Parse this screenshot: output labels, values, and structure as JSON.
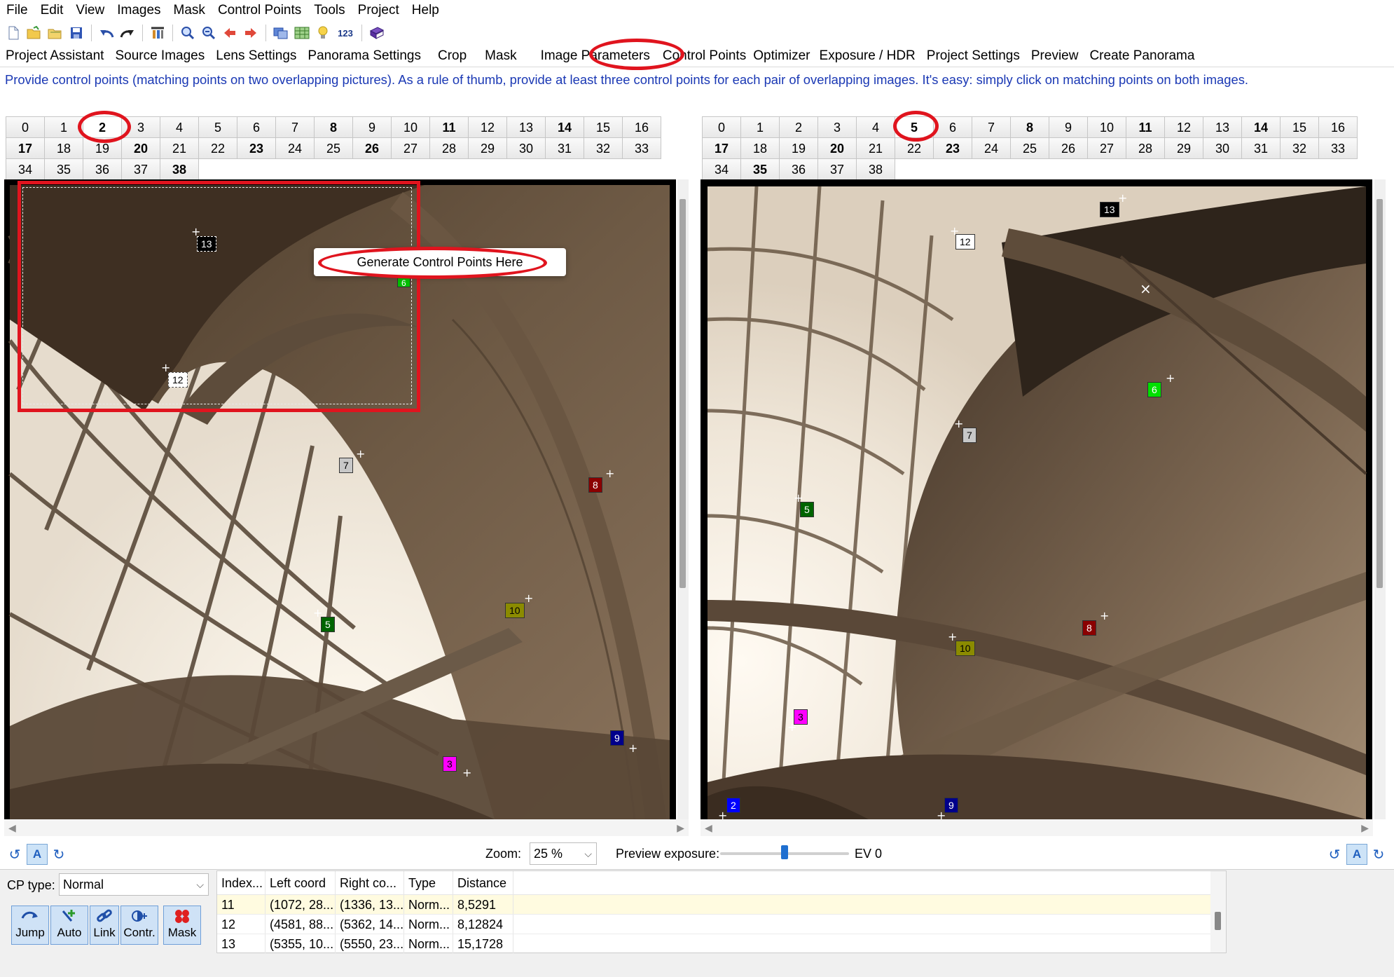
{
  "menu": [
    "File",
    "Edit",
    "View",
    "Images",
    "Mask",
    "Control Points",
    "Tools",
    "Project",
    "Help"
  ],
  "toolbar": {
    "icons": [
      "new-file-icon",
      "open-folder-icon",
      "open-recent-icon",
      "save-icon",
      "undo-icon",
      "redo-icon",
      "assistant-icon",
      "zoom-in-icon",
      "zoom-out-icon",
      "previous-icon",
      "next-icon",
      "images-icon",
      "table-icon",
      "bulb-icon",
      "number-icon",
      "book-icon"
    ],
    "number_label": "123"
  },
  "tabs": [
    "Project Assistant",
    "Source Images",
    "Lens Settings",
    "Panorama Settings",
    "Crop",
    "Mask",
    "Image Parameters",
    "Control Points",
    "Optimizer",
    "Exposure / HDR",
    "Project Settings",
    "Preview",
    "Create Panorama"
  ],
  "active_tab": "Control Points",
  "info_text": "Provide control points (matching points on two overlapping pictures). As a rule of thumb, provide at least three control points for each pair of overlapping images. It's easy: simply click on matching points on both images.",
  "left_images": {
    "numbers": [
      "0",
      "1",
      "2",
      "3",
      "4",
      "5",
      "6",
      "7",
      "8",
      "9",
      "10",
      "11",
      "12",
      "13",
      "14",
      "15",
      "16",
      "17",
      "18",
      "19",
      "20",
      "21",
      "22",
      "23",
      "24",
      "25",
      "26",
      "27",
      "28",
      "29",
      "30",
      "31",
      "32",
      "33",
      "34",
      "35",
      "36",
      "37",
      "38"
    ],
    "bold": [
      "2",
      "8",
      "11",
      "14",
      "17",
      "20",
      "23",
      "26",
      "38"
    ],
    "selected": "2"
  },
  "right_images": {
    "numbers": [
      "0",
      "1",
      "2",
      "3",
      "4",
      "5",
      "6",
      "7",
      "8",
      "9",
      "10",
      "11",
      "12",
      "13",
      "14",
      "15",
      "16",
      "17",
      "18",
      "19",
      "20",
      "21",
      "22",
      "23",
      "24",
      "25",
      "26",
      "27",
      "28",
      "29",
      "30",
      "31",
      "32",
      "33",
      "34",
      "35",
      "36",
      "37",
      "38"
    ],
    "bold": [
      "5",
      "8",
      "11",
      "14",
      "17",
      "20",
      "23",
      "35"
    ],
    "selected": "5"
  },
  "left_points": [
    {
      "label": "13",
      "color": "#000000",
      "text": "#ffffff"
    },
    {
      "label": "6",
      "color": "#00c000",
      "text": "#ffffff"
    },
    {
      "label": "12",
      "color": "#ffffff",
      "text": "#000000"
    },
    {
      "label": "7",
      "color": "#c8c8c8",
      "text": "#000000"
    },
    {
      "label": "8",
      "color": "#8b0000",
      "text": "#ffffff"
    },
    {
      "label": "10",
      "color": "#8b8b00",
      "text": "#000000"
    },
    {
      "label": "5",
      "color": "#006400",
      "text": "#ffffff"
    },
    {
      "label": "9",
      "color": "#00008b",
      "text": "#ffffff"
    },
    {
      "label": "3",
      "color": "#ff00ff",
      "text": "#000000"
    }
  ],
  "right_points": [
    {
      "label": "13",
      "color": "#000000",
      "text": "#ffffff"
    },
    {
      "label": "12",
      "color": "#ffffff",
      "text": "#000000"
    },
    {
      "label": "6",
      "color": "#00e000",
      "text": "#ffffff"
    },
    {
      "label": "7",
      "color": "#c8c8c8",
      "text": "#000000"
    },
    {
      "label": "5",
      "color": "#006400",
      "text": "#ffffff"
    },
    {
      "label": "10",
      "color": "#8b8b00",
      "text": "#000000"
    },
    {
      "label": "8",
      "color": "#8b0000",
      "text": "#ffffff"
    },
    {
      "label": "3",
      "color": "#ff00ff",
      "text": "#000000"
    },
    {
      "label": "2",
      "color": "#0000ff",
      "text": "#ffffff"
    },
    {
      "label": "9",
      "color": "#00008b",
      "text": "#ffffff"
    }
  ],
  "context_menu_item": "Generate Control Points Here",
  "zoom": {
    "label": "Zoom:",
    "value": "25 %"
  },
  "exposure": {
    "label": "Preview exposure:",
    "value": "EV 0"
  },
  "a_button": "A",
  "cp_type": {
    "label": "CP type:",
    "value": "Normal"
  },
  "cp_buttons": [
    {
      "label": "Jump",
      "icon": "jump-icon"
    },
    {
      "label": "Auto",
      "icon": "auto-icon"
    },
    {
      "label": "Link",
      "icon": "link-icon"
    },
    {
      "label": "Contr.",
      "icon": "contrast-icon"
    },
    {
      "label": "Mask",
      "icon": "mask-icon"
    }
  ],
  "cp_table": {
    "headers": [
      "Index...",
      "Left coord",
      "Right co...",
      "Type",
      "Distance"
    ],
    "rows": [
      [
        "11",
        "(1072, 28...",
        "(1336, 13...",
        "Norm...",
        "8,5291"
      ],
      [
        "12",
        "(4581, 88...",
        "(5362, 14...",
        "Norm...",
        "8,12824"
      ],
      [
        "13",
        "(5355, 10...",
        "(5550, 23...",
        "Norm...",
        "15,1728"
      ]
    ]
  },
  "colors": {
    "info_text": "#1a38b4",
    "annotation_red": "#e0141e",
    "selected_row": "#fffbe0"
  }
}
